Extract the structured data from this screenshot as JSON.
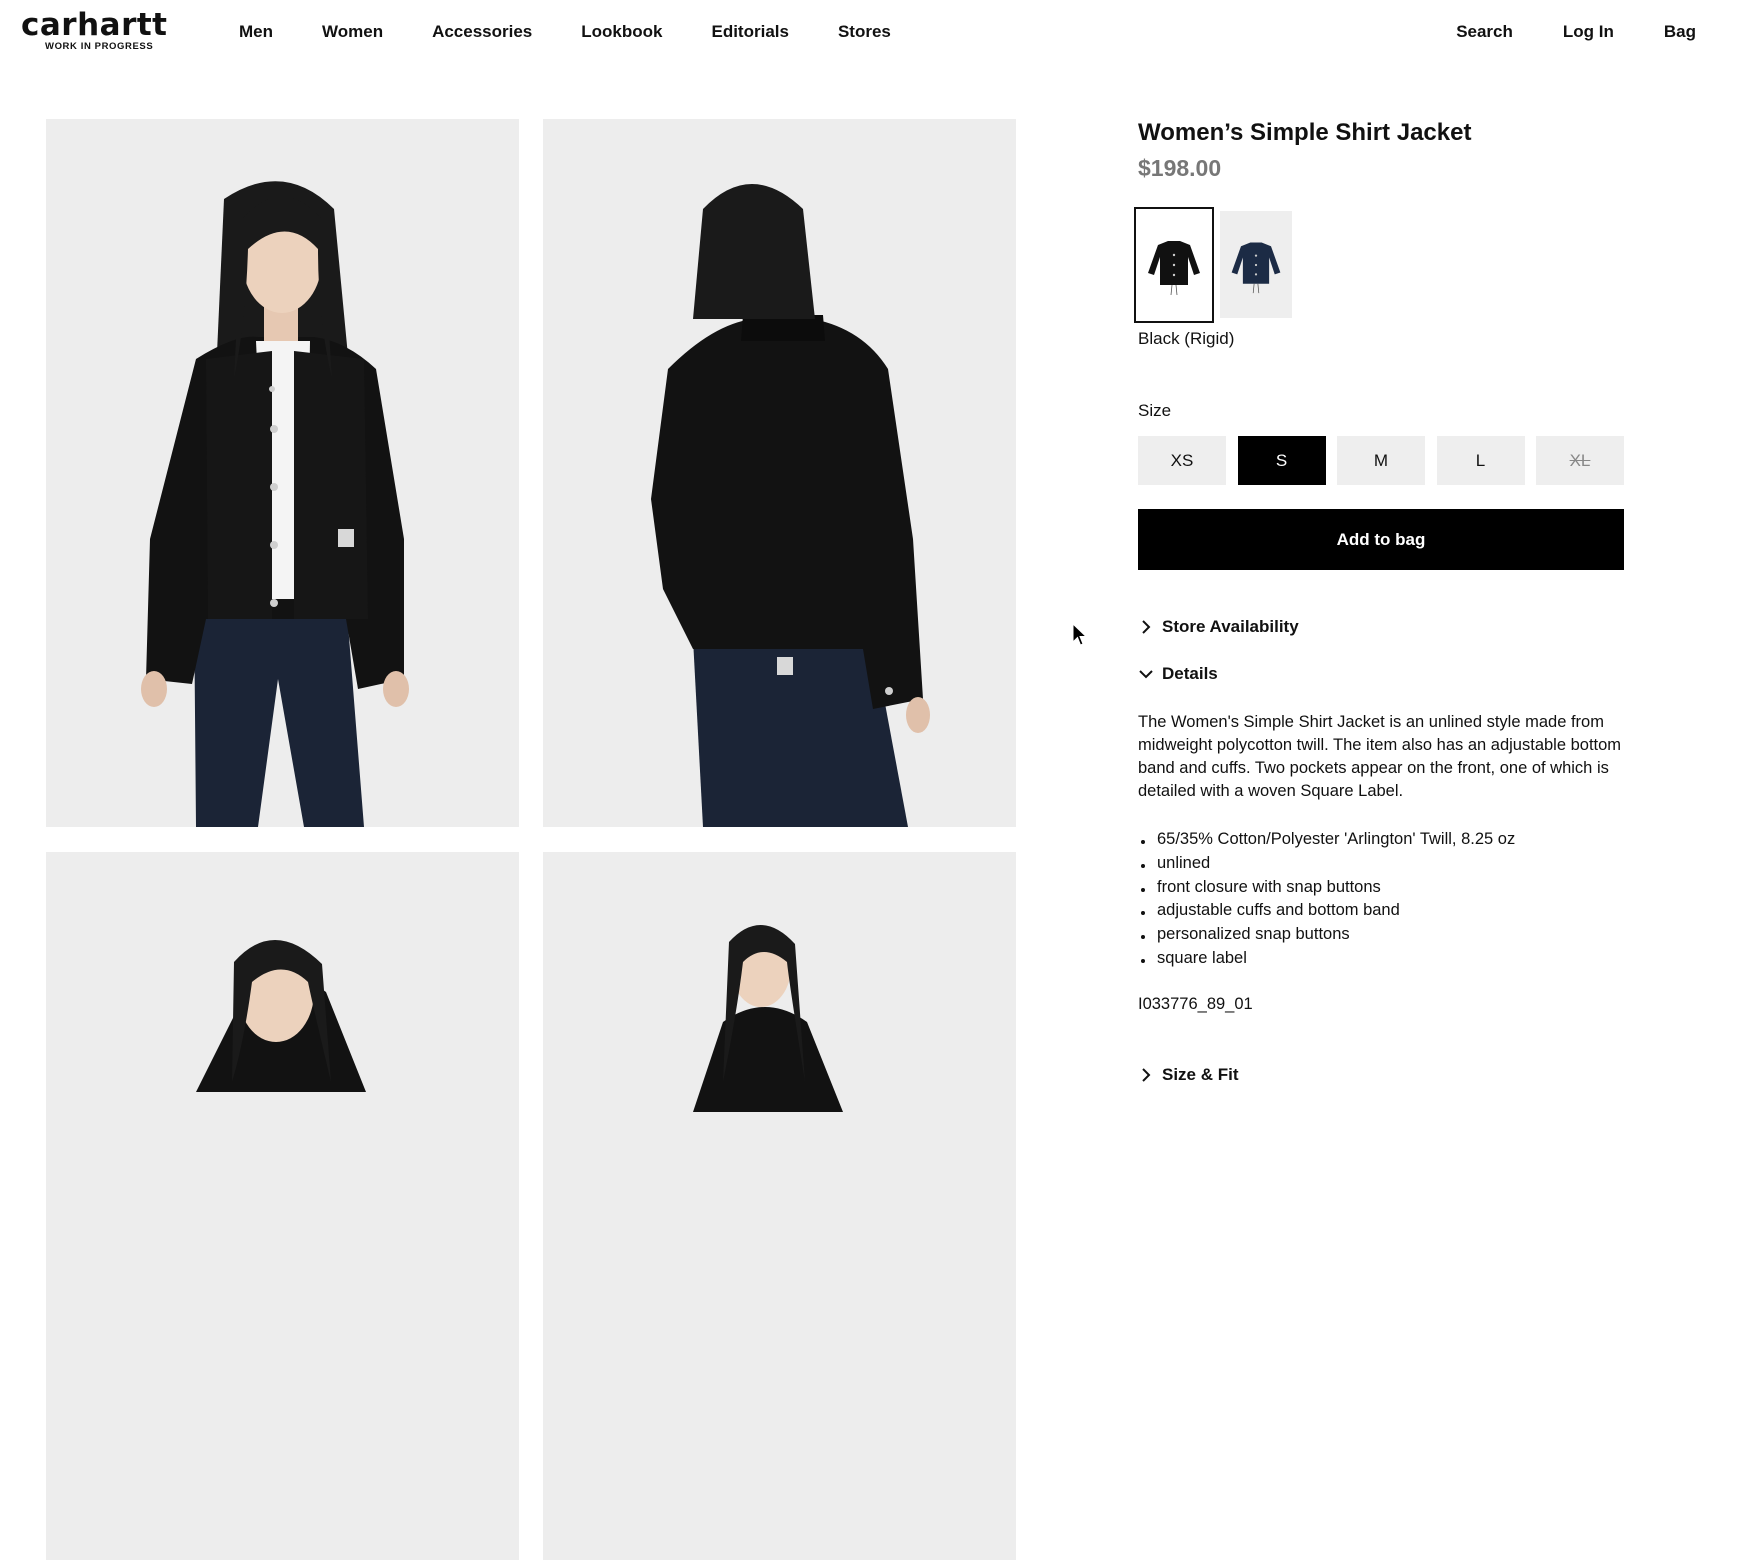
{
  "brand": {
    "name": "carhartt",
    "tagline": "WORK IN PROGRESS"
  },
  "nav": {
    "left": [
      "Men",
      "Women",
      "Accessories",
      "Lookbook",
      "Editorials",
      "Stores"
    ],
    "right": [
      "Search",
      "Log In",
      "Bag"
    ]
  },
  "gallery": {
    "photos": [
      {
        "alt": "front-view"
      },
      {
        "alt": "back-view"
      },
      {
        "alt": "three-quarter-view"
      },
      {
        "alt": "side-view"
      }
    ]
  },
  "product": {
    "title": "Women’s Simple Shirt Jacket",
    "price": "$198.00",
    "swatches": [
      {
        "name": "Black (Rigid)",
        "hex": "#111111",
        "selected": true
      },
      {
        "name": "Navy",
        "hex": "#1c2b45",
        "selected": false
      }
    ],
    "color_label": "Black (Rigid)",
    "size_label": "Size",
    "sizes": [
      {
        "label": "XS",
        "state": "available"
      },
      {
        "label": "S",
        "state": "selected"
      },
      {
        "label": "M",
        "state": "available"
      },
      {
        "label": "L",
        "state": "available"
      },
      {
        "label": "XL",
        "state": "soldout"
      }
    ],
    "add_to_bag": "Add to bag",
    "accordions": {
      "store_availability": "Store Availability",
      "details": "Details",
      "size_fit": "Size & Fit"
    },
    "description": "The Women's Simple Shirt Jacket is an unlined style made from midweight polycotton twill. The item also has an adjustable bottom band and cuffs. Two pockets appear on the front, one of which is detailed with a woven Square Label.",
    "features": [
      "65/35% Cotton/Polyester 'Arlington' Twill, 8.25 oz",
      "unlined",
      "front closure with snap buttons",
      "adjustable cuffs and bottom band",
      "personalized snap buttons",
      "square label"
    ],
    "sku": "I033776_89_01"
  }
}
